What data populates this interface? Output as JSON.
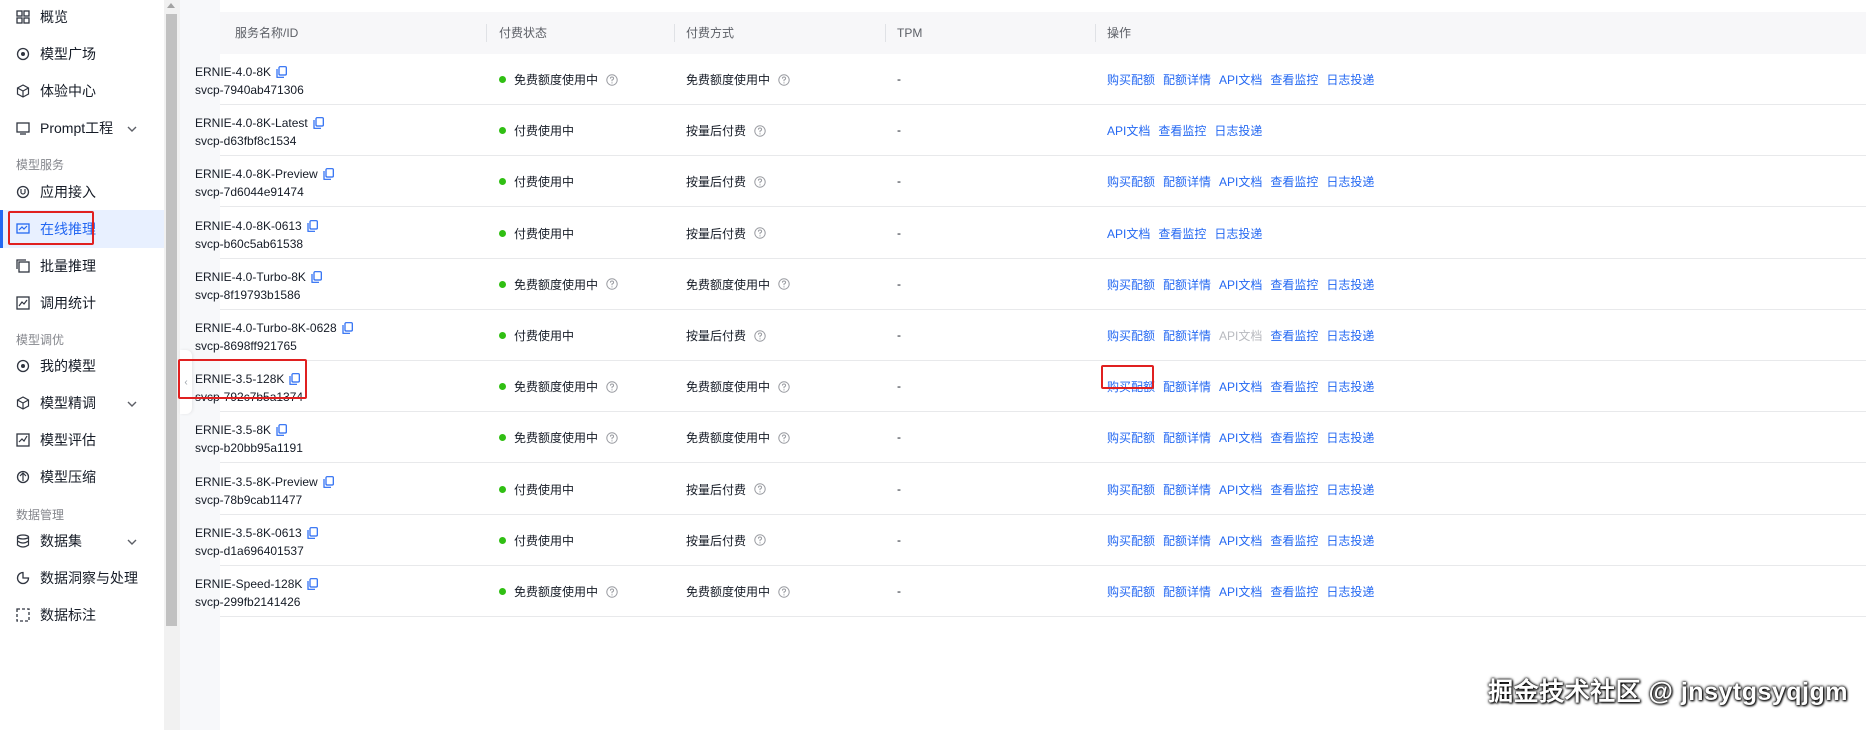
{
  "sidebar": {
    "items": [
      {
        "id": "overview",
        "label": "概览",
        "icon": "grid-icon"
      },
      {
        "id": "model-square",
        "label": "模型广场",
        "icon": "target-icon"
      },
      {
        "id": "experience",
        "label": "体验中心",
        "icon": "cube-icon"
      },
      {
        "id": "prompt",
        "label": "Prompt工程",
        "icon": "prompt-icon",
        "expandable": true
      }
    ],
    "section_model_service": "模型服务",
    "service_items": [
      {
        "id": "app-access",
        "label": "应用接入",
        "icon": "plug-icon"
      },
      {
        "id": "online-inference",
        "label": "在线推理",
        "icon": "monitor-icon",
        "active": true
      },
      {
        "id": "batch-inference",
        "label": "批量推理",
        "icon": "batch-icon"
      },
      {
        "id": "usage-stats",
        "label": "调用统计",
        "icon": "chart-icon"
      }
    ],
    "section_model_tuning": "模型调优",
    "tuning_items": [
      {
        "id": "my-models",
        "label": "我的模型",
        "icon": "target-icon"
      },
      {
        "id": "fine-tune",
        "label": "模型精调",
        "icon": "cube-icon",
        "expandable": true
      },
      {
        "id": "evaluate",
        "label": "模型评估",
        "icon": "evaluate-icon"
      },
      {
        "id": "compress",
        "label": "模型压缩",
        "icon": "compress-icon"
      }
    ],
    "section_data": "数据管理",
    "data_items": [
      {
        "id": "datasets",
        "label": "数据集",
        "icon": "database-icon",
        "expandable": true
      },
      {
        "id": "insight",
        "label": "数据洞察与处理",
        "icon": "pie-icon"
      },
      {
        "id": "annotate",
        "label": "数据标注",
        "icon": "tag-icon"
      }
    ]
  },
  "table": {
    "headers": {
      "name": "服务名称/ID",
      "pay_status": "付费状态",
      "pay_method": "付费方式",
      "tpm": "TPM",
      "actions": "操作"
    },
    "rows": [
      {
        "name": "ERNIE-4.0-8K",
        "id": "svcp-7940ab471306",
        "status": "免费额度使用中",
        "status_help": true,
        "method": "免费额度使用中",
        "tpm": "-",
        "actions": [
          "购买配额",
          "配额详情",
          "API文档",
          "查看监控",
          "日志投递"
        ]
      },
      {
        "name": "ERNIE-4.0-8K-Latest",
        "id": "svcp-d63fbf8c1534",
        "status": "付费使用中",
        "status_help": false,
        "method": "按量后付费",
        "tpm": "-",
        "actions": [
          "API文档",
          "查看监控",
          "日志投递"
        ]
      },
      {
        "name": "ERNIE-4.0-8K-Preview",
        "id": "svcp-7d6044e91474",
        "status": "付费使用中",
        "status_help": false,
        "method": "按量后付费",
        "tpm": "-",
        "actions": [
          "购买配额",
          "配额详情",
          "API文档",
          "查看监控",
          "日志投递"
        ]
      },
      {
        "name": "ERNIE-4.0-8K-0613",
        "id": "svcp-b60c5ab61538",
        "status": "付费使用中",
        "status_help": false,
        "method": "按量后付费",
        "tpm": "-",
        "actions": [
          "API文档",
          "查看监控",
          "日志投递"
        ]
      },
      {
        "name": "ERNIE-4.0-Turbo-8K",
        "id": "svcp-8f19793b1586",
        "status": "免费额度使用中",
        "status_help": true,
        "method": "免费额度使用中",
        "tpm": "-",
        "actions": [
          "购买配额",
          "配额详情",
          "API文档",
          "查看监控",
          "日志投递"
        ]
      },
      {
        "name": "ERNIE-4.0-Turbo-8K-0628",
        "id": "svcp-8698ff921765",
        "status": "付费使用中",
        "status_help": false,
        "method": "按量后付费",
        "tpm": "-",
        "actions": [
          "购买配额",
          "配额详情",
          "API文档",
          "查看监控",
          "日志投递"
        ],
        "disabled_action": "API文档"
      },
      {
        "name": "ERNIE-3.5-128K",
        "id": "svcp-792c7b5a1374",
        "status": "免费额度使用中",
        "status_help": true,
        "method": "免费额度使用中",
        "tpm": "-",
        "actions": [
          "购买配额",
          "配额详情",
          "API文档",
          "查看监控",
          "日志投递"
        ],
        "highlighted": true
      },
      {
        "name": "ERNIE-3.5-8K",
        "id": "svcp-b20bb95a1191",
        "status": "免费额度使用中",
        "status_help": true,
        "method": "免费额度使用中",
        "tpm": "-",
        "actions": [
          "购买配额",
          "配额详情",
          "API文档",
          "查看监控",
          "日志投递"
        ]
      },
      {
        "name": "ERNIE-3.5-8K-Preview",
        "id": "svcp-78b9cab11477",
        "status": "付费使用中",
        "status_help": false,
        "method": "按量后付费",
        "tpm": "-",
        "actions": [
          "购买配额",
          "配额详情",
          "API文档",
          "查看监控",
          "日志投递"
        ]
      },
      {
        "name": "ERNIE-3.5-8K-0613",
        "id": "svcp-d1a696401537",
        "status": "付费使用中",
        "status_help": false,
        "method": "按量后付费",
        "tpm": "-",
        "actions": [
          "购买配额",
          "配额详情",
          "API文档",
          "查看监控",
          "日志投递"
        ]
      },
      {
        "name": "ERNIE-Speed-128K",
        "id": "svcp-299fb2141426",
        "status": "免费额度使用中",
        "status_help": true,
        "method": "免费额度使用中",
        "tpm": "-",
        "actions": [
          "购买配额",
          "配额详情",
          "API文档",
          "查看监控",
          "日志投递"
        ]
      }
    ]
  },
  "watermark": "掘金技术社区 @ jnsytgsyqjgm",
  "colors": {
    "accent": "#2468f2",
    "status_dot": "#30bf13",
    "highlight_border": "#e02020"
  }
}
